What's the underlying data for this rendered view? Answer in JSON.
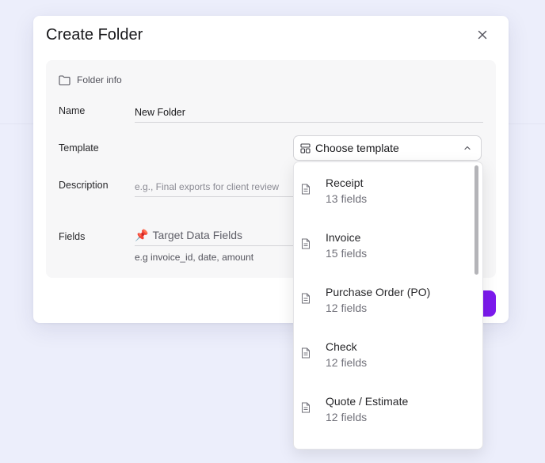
{
  "modal": {
    "title": "Create Folder",
    "section_title": "Folder info",
    "name_label": "Name",
    "name_value": "New Folder",
    "template_label": "Template",
    "template_placeholder": "Choose template",
    "description_label": "Description",
    "description_placeholder": "e.g., Final exports for client review",
    "fields_label": "Fields",
    "fields_emoji": "📌",
    "fields_placeholder": "Target Data Fields",
    "fields_hint": "e.g invoice_id, date, amount"
  },
  "dropdown": {
    "items": [
      {
        "name": "Receipt",
        "count": "13 fields"
      },
      {
        "name": "Invoice",
        "count": "15 fields"
      },
      {
        "name": "Purchase Order (PO)",
        "count": "12 fields"
      },
      {
        "name": "Check",
        "count": "12 fields"
      },
      {
        "name": "Quote / Estimate",
        "count": "12 fields"
      }
    ]
  },
  "icons": [
    "close-icon",
    "folder-icon",
    "template-icon",
    "chevron-up-icon",
    "document-icon"
  ],
  "colors": {
    "accent": "#7c1aee",
    "background": "#eceefb"
  }
}
